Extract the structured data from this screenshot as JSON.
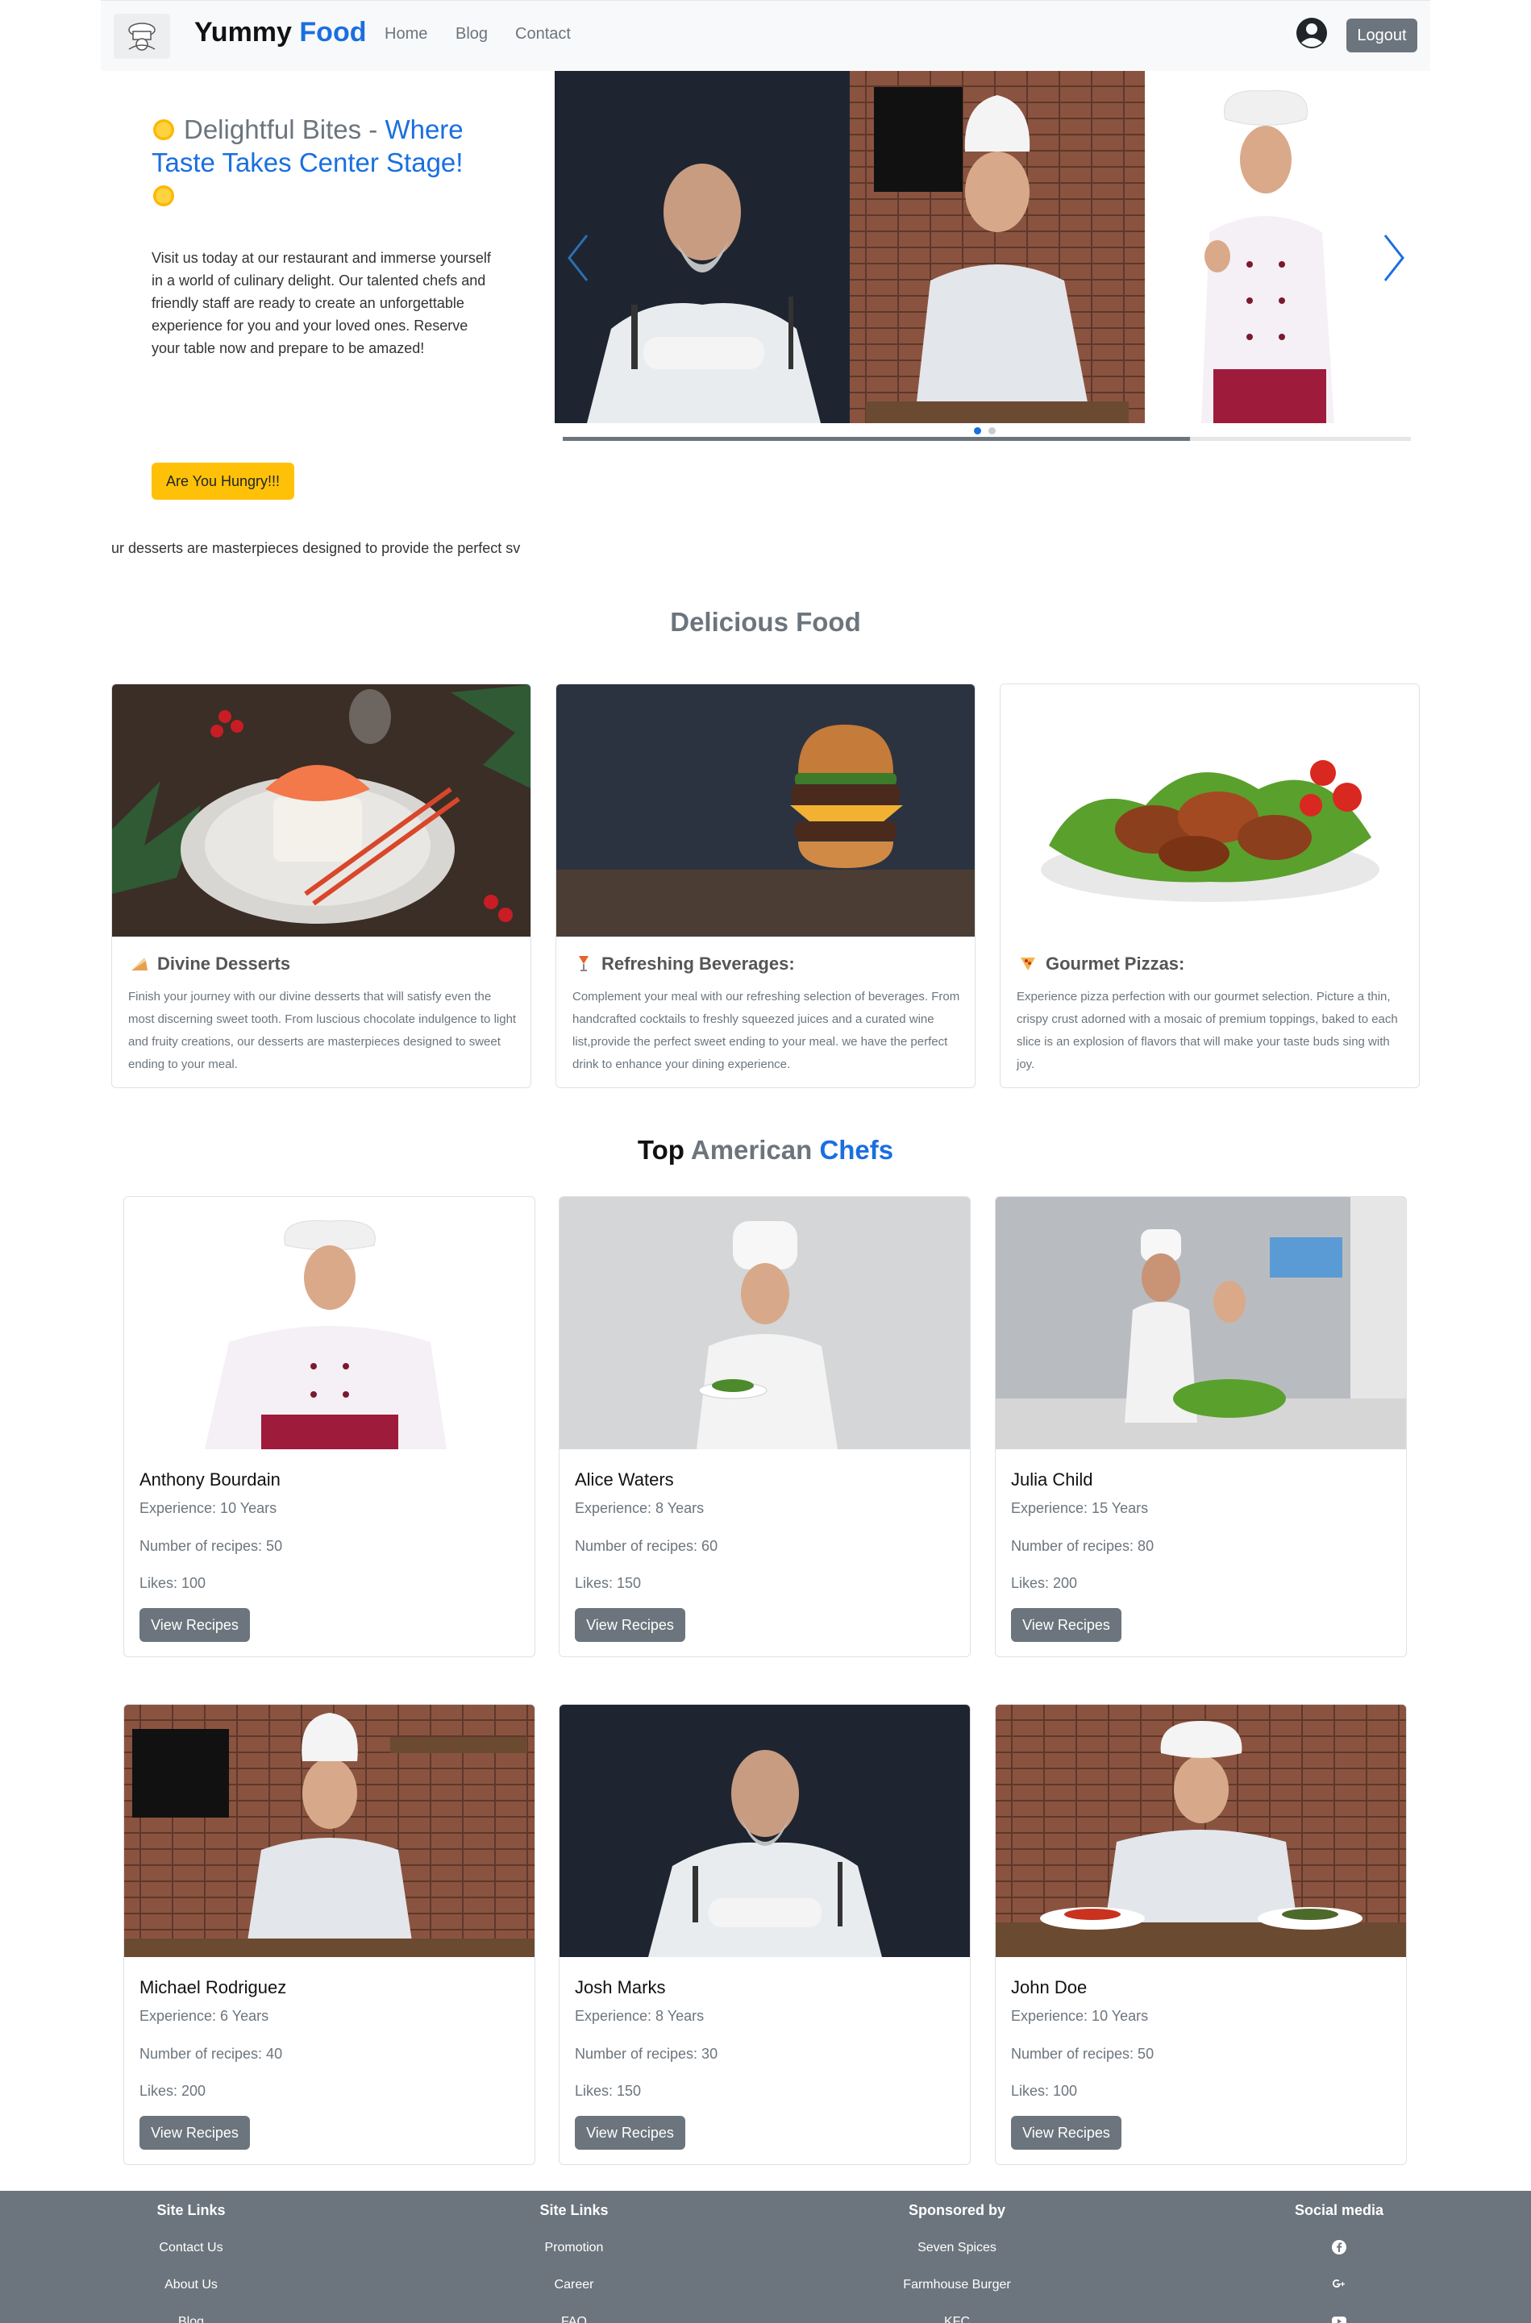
{
  "navbar": {
    "brand_text": "Yummy",
    "brand_accent": "Food",
    "links": [
      "Home",
      "Blog",
      "Contact"
    ],
    "logout_label": "Logout"
  },
  "hero": {
    "title_gray": "Delightful Bites - ",
    "title_blue": "Where Taste Takes Center Stage!",
    "text": "Visit us today at our restaurant and immerse yourself in a world of culinary delight. Our talented chefs and friendly staff are ready to create an unforgettable experience for you and your loved ones. Reserve your table now and prepare to be amazed!",
    "button_label": "Are You Hungry!!!",
    "marquee_text": "ur desserts are masterpieces designed to provide the perfect sv"
  },
  "carousel": {
    "active_dot": 0,
    "dot_count": 2,
    "progress": 0.74
  },
  "food_section": {
    "title": "Delicious Food",
    "cards": [
      {
        "title": "Divine Desserts",
        "text": "Finish your journey with our divine desserts that will satisfy even the most discerning sweet tooth. From luscious chocolate indulgence to light and fruity creations, our desserts are masterpieces designed to sweet ending to your meal."
      },
      {
        "title": "Refreshing Beverages:",
        "text": "Complement your meal with our refreshing selection of beverages. From handcrafted cocktails to freshly squeezed juices and a curated wine list,provide the perfect sweet ending to your meal. we have the perfect drink to enhance your dining experience."
      },
      {
        "title": "Gourmet Pizzas:",
        "text": "Experience pizza perfection with our gourmet selection. Picture a thin, crispy crust adorned with a mosaic of premium toppings, baked to each slice is an explosion of flavors that will make your taste buds sing with joy."
      }
    ]
  },
  "chefs_section": {
    "title_1": "Top",
    "title_2": "American",
    "title_3": "Chefs",
    "button_label": "View Recipes",
    "chefs": [
      {
        "name": "Anthony Bourdain",
        "experience": "Experience: 10 Years",
        "recipes": "Number of recipes: 50",
        "likes": "Likes: 100"
      },
      {
        "name": "Alice Waters",
        "experience": "Experience: 8 Years",
        "recipes": "Number of recipes: 60",
        "likes": "Likes: 150"
      },
      {
        "name": "Julia Child",
        "experience": "Experience: 15 Years",
        "recipes": "Number of recipes: 80",
        "likes": "Likes: 200"
      },
      {
        "name": "Michael Rodriguez",
        "experience": "Experience: 6 Years",
        "recipes": "Number of recipes: 40",
        "likes": "Likes: 200"
      },
      {
        "name": "Josh Marks",
        "experience": "Experience: 8 Years",
        "recipes": "Number of recipes: 30",
        "likes": "Likes: 150"
      },
      {
        "name": "John Doe",
        "experience": "Experience: 10 Years",
        "recipes": "Number of recipes: 50",
        "likes": "Likes: 100"
      }
    ]
  },
  "footer": {
    "col1": {
      "heading": "Site Links",
      "items": [
        "Contact Us",
        "About Us",
        "Blog"
      ]
    },
    "col2": {
      "heading": "Site Links",
      "items": [
        "Promotion",
        "Career",
        "FAQ"
      ]
    },
    "col3": {
      "heading": "Sponsored by",
      "items": [
        "Seven Spices",
        "Farmhouse Burger",
        "KFC"
      ]
    },
    "col4": {
      "heading": "Social media",
      "icons": [
        "facebook-icon",
        "google-plus-icon",
        "youtube-icon"
      ]
    }
  },
  "colors": {
    "accent_blue": "#1a6fe0",
    "button_gray": "#6c757d",
    "hungry_yellow": "#ffc107"
  }
}
